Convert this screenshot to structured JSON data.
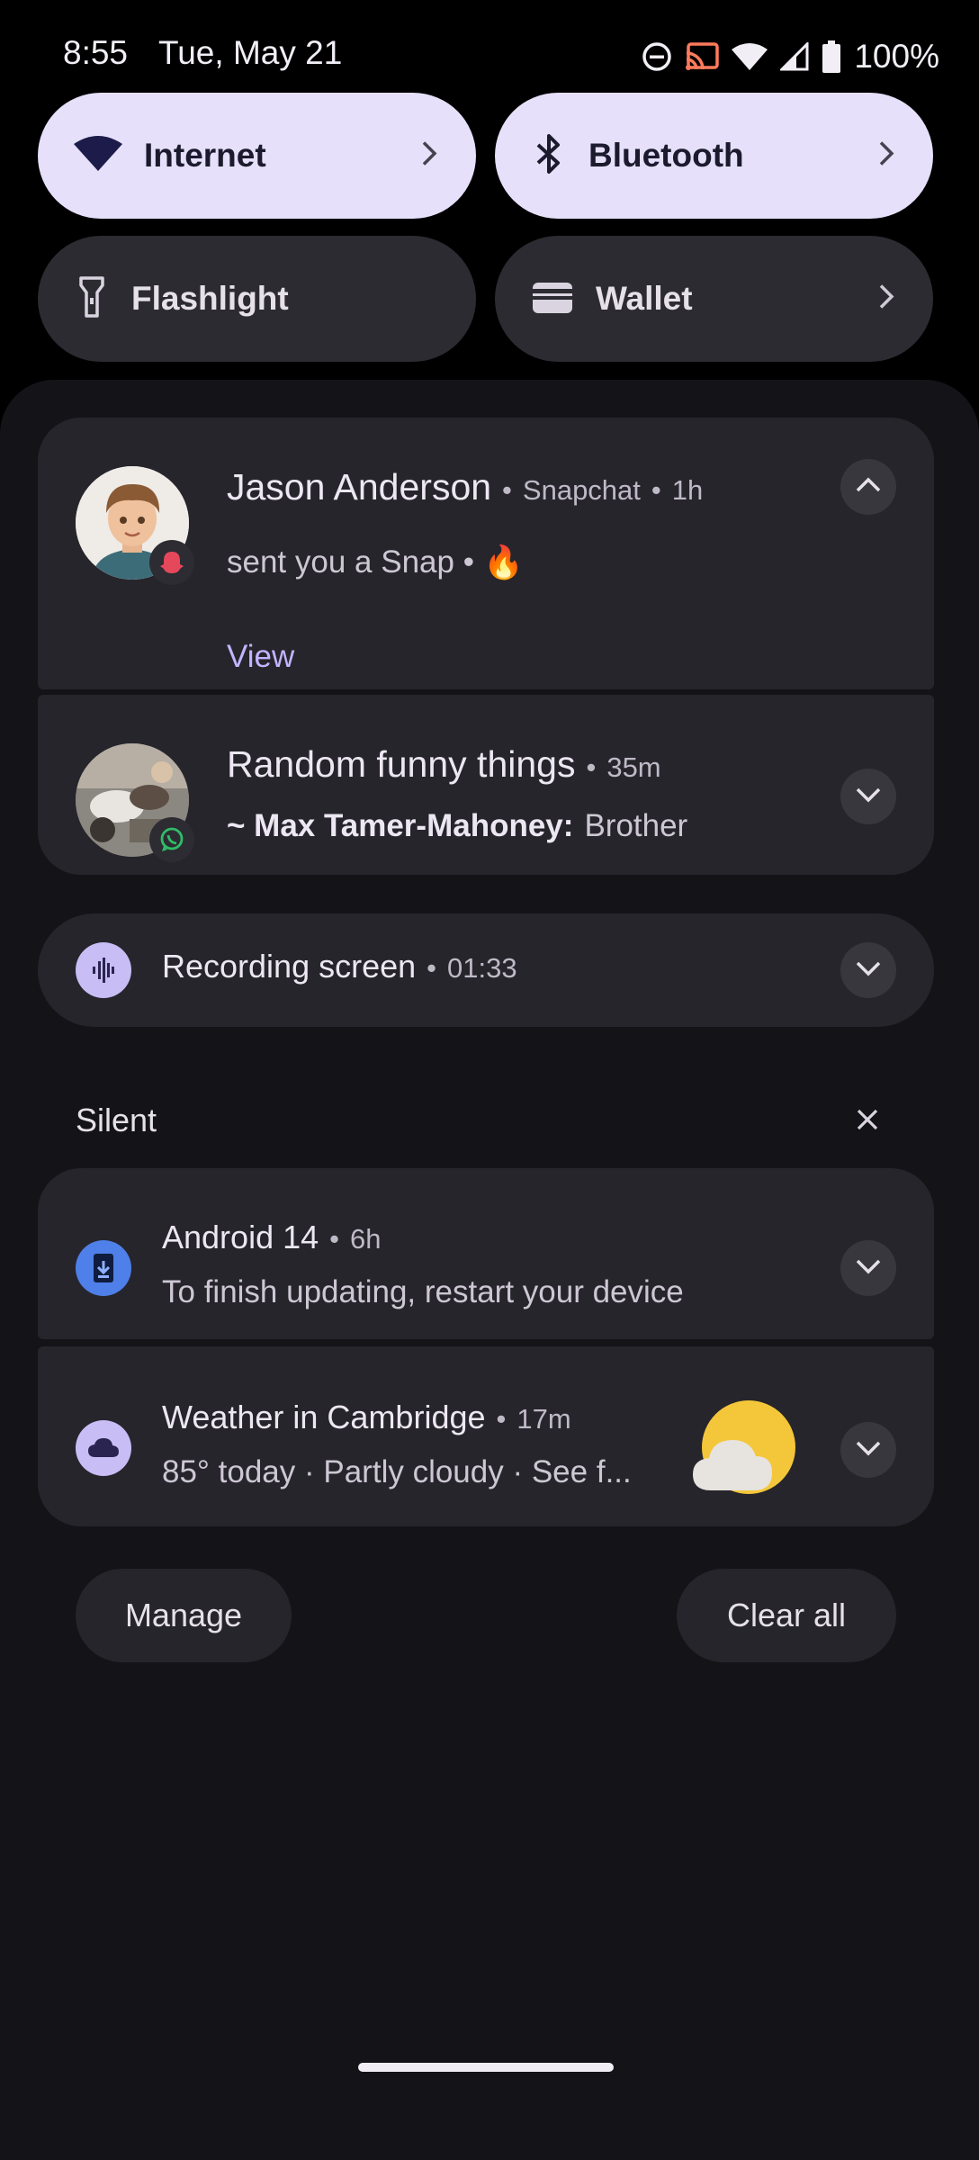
{
  "status_bar": {
    "time": "8:55",
    "date": "Tue, May 21",
    "battery": "100%",
    "icons": [
      "do-not-disturb-icon",
      "cast-icon",
      "wifi-icon",
      "signal-icon",
      "battery-icon"
    ]
  },
  "quick_settings": [
    {
      "label": "Internet",
      "icon": "wifi-icon",
      "active": true,
      "has_chevron": true
    },
    {
      "label": "Bluetooth",
      "icon": "bluetooth-icon",
      "active": true,
      "has_chevron": true
    },
    {
      "label": "Flashlight",
      "icon": "flashlight-icon",
      "active": false,
      "has_chevron": false
    },
    {
      "label": "Wallet",
      "icon": "wallet-icon",
      "active": false,
      "has_chevron": true
    }
  ],
  "notifications": {
    "snapchat": {
      "sender": "Jason Anderson",
      "app": "Snapchat",
      "time": "1h",
      "message": "sent you a Snap •",
      "emoji": "🔥",
      "action": "View"
    },
    "whatsapp": {
      "title": "Random funny things",
      "time": "35m",
      "sender": "~ Max Tamer-Mahoney:",
      "message": "Brother"
    },
    "recording": {
      "title": "Recording screen",
      "time": "01:33"
    }
  },
  "silent_section": {
    "header": "Silent",
    "android": {
      "title": "Android 14",
      "time": "6h",
      "message": "To finish updating, restart your device"
    },
    "weather": {
      "title": "Weather in Cambridge",
      "time": "17m",
      "message": "85° today · Partly cloudy · See f..."
    }
  },
  "footer": {
    "manage_label": "Manage",
    "clear_label": "Clear all"
  },
  "colors": {
    "accent_tile": "#e6e0fa",
    "card_bg": "#26252b",
    "shade_bg": "#141318",
    "link": "#c3b4ff"
  }
}
